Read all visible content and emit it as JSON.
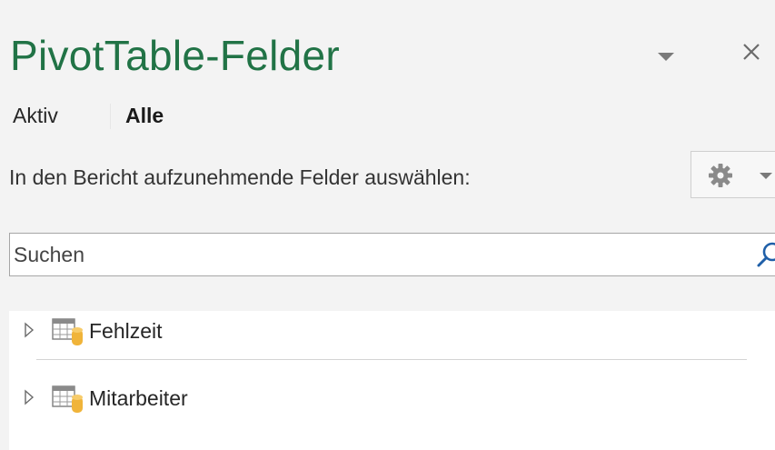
{
  "pane": {
    "title": "PivotTable-Felder",
    "accent_color": "#217346",
    "dropdown_icon": "caret-down-icon",
    "close_icon": "close-icon"
  },
  "tabs": [
    {
      "label": "Aktiv",
      "selected": false
    },
    {
      "label": "Alle",
      "selected": true
    }
  ],
  "instruction": "In den Bericht aufzunehmende Felder auswählen:",
  "tools": {
    "icon": "gear-icon",
    "dropdown_icon": "caret-down-icon"
  },
  "search": {
    "placeholder": "Suchen",
    "value": "",
    "icon": "search-icon"
  },
  "fields": [
    {
      "label": "Fehlzeit",
      "icon": "table-icon",
      "expand_icon": "expand-triangle-icon"
    },
    {
      "label": "Mitarbeiter",
      "icon": "table-icon",
      "expand_icon": "expand-triangle-icon"
    }
  ]
}
